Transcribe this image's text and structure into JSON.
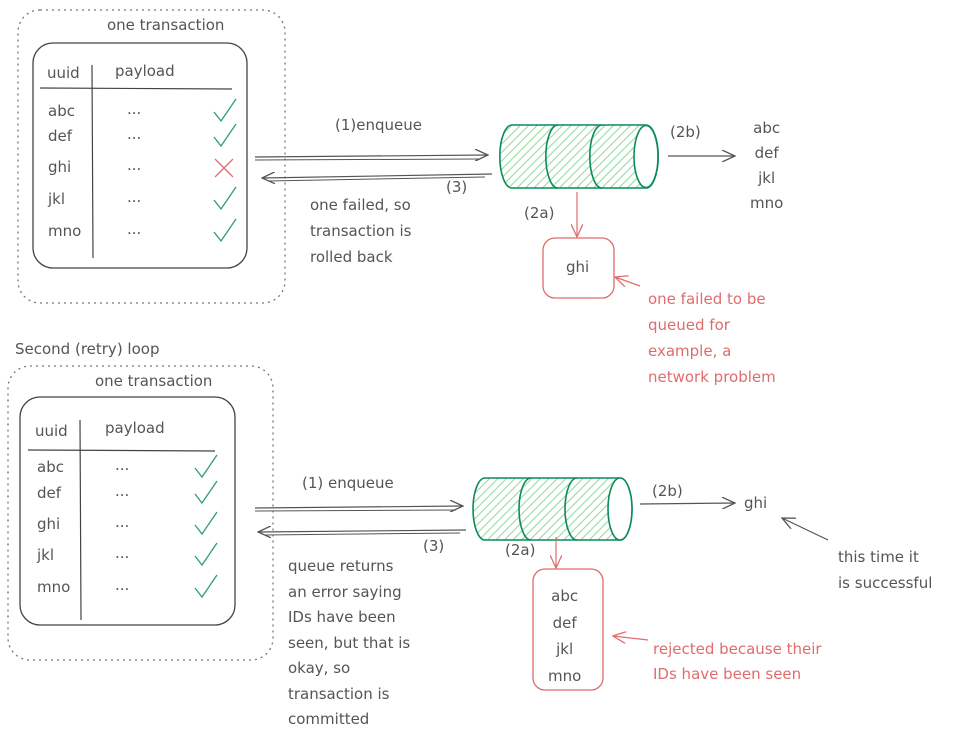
{
  "colors": {
    "ink": "#555555",
    "queue": "#0c8a5c",
    "queue_fill": "#b2f2bb",
    "error": "#e06c6c",
    "check": "#2f9e6e"
  },
  "first": {
    "group_label": "one transaction",
    "table": {
      "headers": [
        "uuid",
        "payload"
      ],
      "rows": [
        {
          "uuid": "abc",
          "payload": "...",
          "status": "check"
        },
        {
          "uuid": "def",
          "payload": "...",
          "status": "check"
        },
        {
          "uuid": "ghi",
          "payload": "...",
          "status": "cross"
        },
        {
          "uuid": "jkl",
          "payload": "...",
          "status": "check"
        },
        {
          "uuid": "mno",
          "payload": "...",
          "status": "check"
        }
      ]
    },
    "enqueue_label": "(1)enqueue",
    "return_label": "(3)",
    "return_note": [
      "one failed, so",
      "transaction is",
      "rolled back"
    ],
    "step_2b": "(2b)",
    "delivered": [
      "abc",
      "def",
      "jkl",
      "mno"
    ],
    "step_2a": "(2a)",
    "rejected": [
      "ghi"
    ],
    "error_note": [
      "one failed to be",
      "queued for",
      "example, a",
      "network problem"
    ]
  },
  "second": {
    "title": "Second (retry) loop",
    "group_label": "one transaction",
    "table": {
      "headers": [
        "uuid",
        "payload"
      ],
      "rows": [
        {
          "uuid": "abc",
          "payload": "...",
          "status": "check"
        },
        {
          "uuid": "def",
          "payload": "...",
          "status": "check"
        },
        {
          "uuid": "ghi",
          "payload": "...",
          "status": "check"
        },
        {
          "uuid": "jkl",
          "payload": "...",
          "status": "check"
        },
        {
          "uuid": "mno",
          "payload": "...",
          "status": "check"
        }
      ]
    },
    "enqueue_label": "(1) enqueue",
    "return_label": "(3)",
    "return_note": [
      "queue returns",
      "an error saying",
      "IDs have been",
      "seen, but that is",
      "okay, so",
      "transaction is",
      "committed"
    ],
    "step_2b": "(2b)",
    "delivered": [
      "ghi"
    ],
    "success_note": [
      "this time it",
      "is successful"
    ],
    "step_2a": "(2a)",
    "rejected": [
      "abc",
      "def",
      "jkl",
      "mno"
    ],
    "error_note": [
      "rejected because their",
      "IDs have been seen"
    ]
  }
}
